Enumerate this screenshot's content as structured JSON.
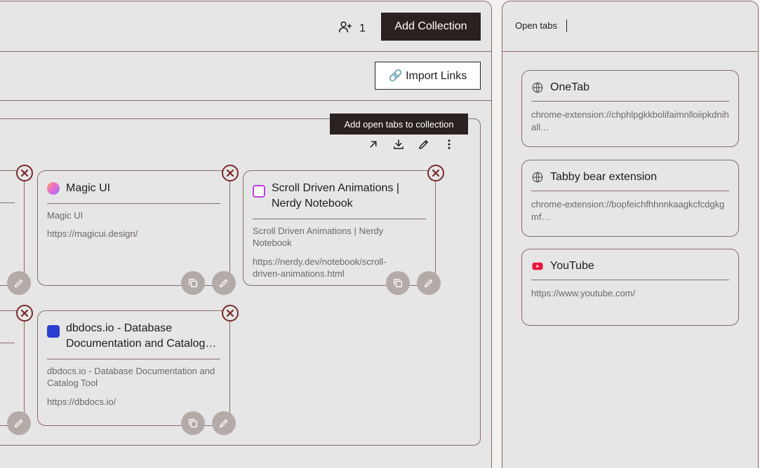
{
  "header": {
    "user_count": "1",
    "add_collection_label": "Add Collection"
  },
  "toolbar": {
    "import_links_label": "🔗 Import Links"
  },
  "collection": {
    "tooltip": "Add open tabs to collection",
    "cards": [
      {
        "title": "Magic UI",
        "description": "Magic UI",
        "url": "https://magicui.design/"
      },
      {
        "title": "Scroll Driven Animations | Nerdy Notebook",
        "description": "Scroll Driven Animations | Nerdy Notebook",
        "url": "https://nerdy.dev/notebook/scroll-driven-animations.html"
      },
      {
        "title": "dbdocs.io - Database Documentation and Catalog…",
        "description": "dbdocs.io - Database Documentation and Catalog Tool",
        "url": "https://dbdocs.io/"
      }
    ]
  },
  "side": {
    "label": "Open tabs",
    "tabs": [
      {
        "title": "OneTab",
        "url": "chrome-extension://chphlpgkkbolifaimnlloiipkdnihall…"
      },
      {
        "title": "Tabby bear extension",
        "url": "chrome-extension://bopfeichfhhnnkaagkcfcdgkgmf…"
      },
      {
        "title": "YouTube",
        "url": "https://www.youtube.com/"
      }
    ]
  },
  "colors": {
    "accent_dark": "#2a2220",
    "border": "#8a6a66",
    "close_red": "#7a2a2a",
    "youtube_red": "#e8163c"
  },
  "icons": [
    "user-plus-icon",
    "link-icon",
    "arrow-up-right-icon",
    "download-icon",
    "pencil-icon",
    "more-vertical-icon",
    "close-icon",
    "copy-icon",
    "globe-icon",
    "youtube-icon"
  ]
}
